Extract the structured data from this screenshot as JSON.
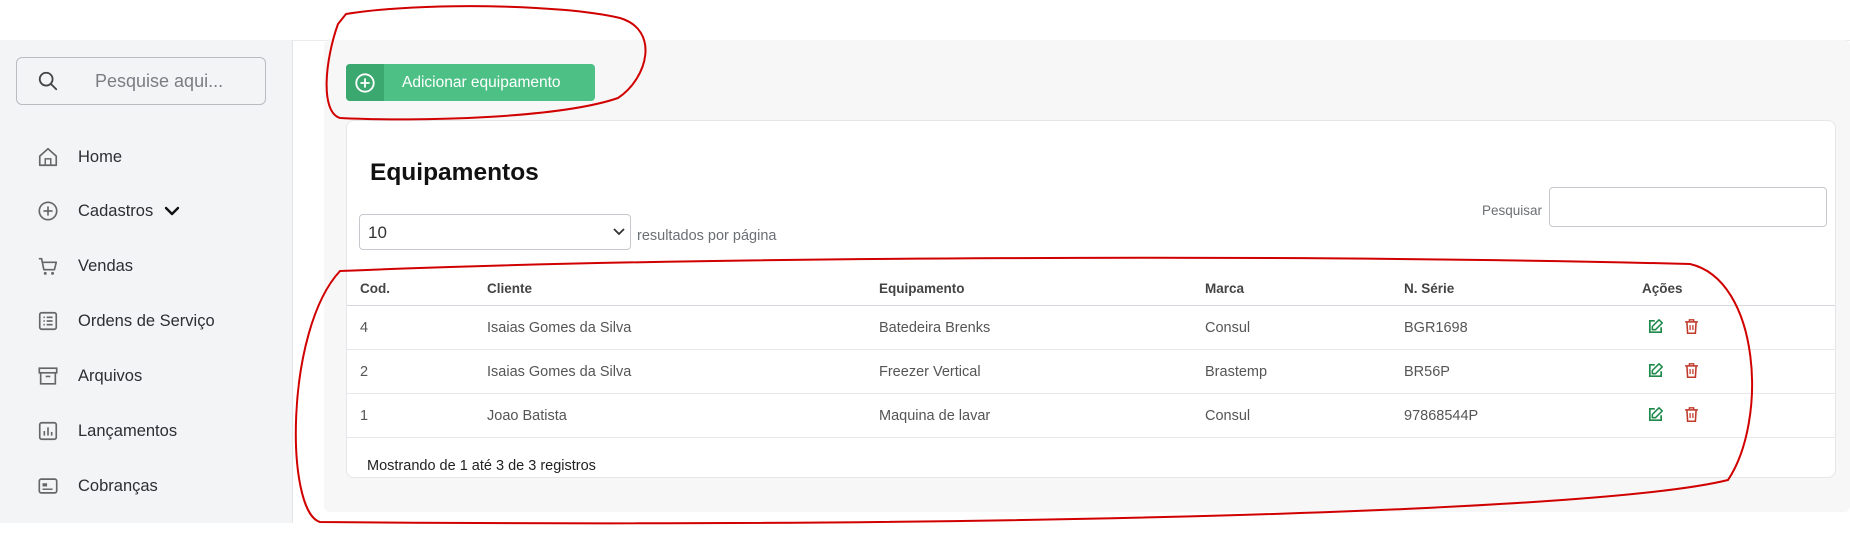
{
  "sidebar": {
    "search": {
      "placeholder": "Pesquise aqui..."
    },
    "items": [
      {
        "label": "Home",
        "icon": "home-icon"
      },
      {
        "label": "Cadastros",
        "icon": "plus-circle-icon"
      },
      {
        "label": "Vendas",
        "icon": "cart-icon"
      },
      {
        "label": "Ordens de Serviço",
        "icon": "list-icon"
      },
      {
        "label": "Arquivos",
        "icon": "archive-icon"
      },
      {
        "label": "Lançamentos",
        "icon": "bar-chart-icon"
      },
      {
        "label": "Cobranças",
        "icon": "card-icon"
      }
    ]
  },
  "toolbar": {
    "add_label": "Adicionar equipamento"
  },
  "card": {
    "title": "Equipamentos",
    "page_size": "10",
    "page_size_suffix": "resultados por página",
    "filter_label": "Pesquisar"
  },
  "table": {
    "headers": [
      "Cod.",
      "Cliente",
      "Equipamento",
      "Marca",
      "N. Série",
      "Ações"
    ],
    "rows": [
      [
        "4",
        "Isaias Gomes da Silva",
        "Batedeira Brenks",
        "Consul",
        "BGR1698"
      ],
      [
        "2",
        "Isaias Gomes da Silva",
        "Freezer Vertical",
        "Brastemp",
        "BR56P"
      ],
      [
        "1",
        "Joao Batista",
        "Maquina de lavar",
        "Consul",
        "97868544P"
      ]
    ]
  },
  "footer": {
    "info": "Mostrando de 1 até 3 de 3 registros"
  },
  "colors": {
    "accent_green": "#4dc085",
    "edit_icon": "#1f8a4c",
    "delete_icon": "#c0392b",
    "annotation_red": "#d10000"
  }
}
